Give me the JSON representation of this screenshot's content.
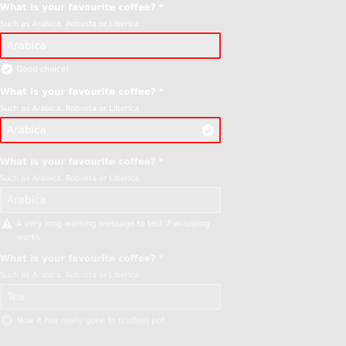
{
  "fields": [
    {
      "label": "What is your favourite coffee? *",
      "hint": "Such as Arabica, Robusta or Liberica",
      "value": "Arabica",
      "message": "Good choice!",
      "message_icon": "check-circle-icon"
    },
    {
      "label": "What is your favourite coffee? *",
      "hint": "Such as Arabica, Robusta or Liberica",
      "value": "Arabica",
      "input_icon": "check-circle-icon"
    },
    {
      "label": "What is your favourite coffee? *",
      "hint": "Such as Arabica, Robusta or Liberica",
      "value": "Arabica",
      "message": "A very long warning message to test if wrapping works",
      "message_icon": "warning-icon"
    },
    {
      "label": "What is your favourite coffee? *",
      "hint": "Such as Arabica, Robusta or Liberica",
      "value": "Tea",
      "message": "Now it has really gone to (coffee) pot",
      "message_icon": "error-circle-icon"
    }
  ],
  "colors": {
    "background": "#e6e6e6",
    "error_border": "#ff0000",
    "text": "#ffffff"
  }
}
